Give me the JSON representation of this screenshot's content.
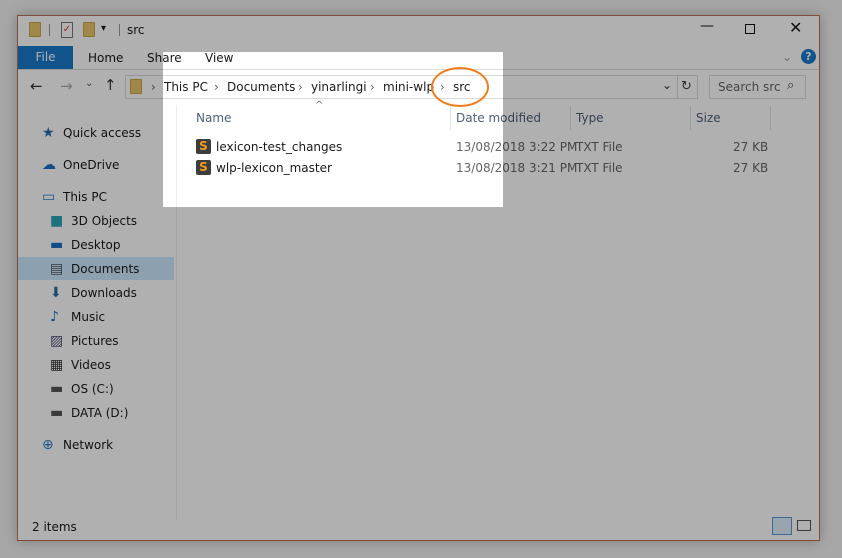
{
  "window": {
    "title": "src",
    "accent": "#1979ca",
    "highlight_color": "#f07c1c"
  },
  "ribbon": {
    "tabs": [
      "File",
      "Home",
      "Share",
      "View"
    ]
  },
  "address": {
    "path": [
      "This PC",
      "Documents",
      "yinarlingi",
      "mini-wlp",
      "src"
    ],
    "search_placeholder": "Search src"
  },
  "columns": {
    "name": "Name",
    "date": "Date modified",
    "type": "Type",
    "size": "Size"
  },
  "files": [
    {
      "name": "lexicon-test_changes",
      "date": "13/08/2018 3:22 PM",
      "type": "TXT File",
      "size": "27 KB",
      "icon": "sublime-text-icon"
    },
    {
      "name": "wlp-lexicon_master",
      "date": "13/08/2018 3:21 PM",
      "type": "TXT File",
      "size": "27 KB",
      "icon": "sublime-text-icon"
    }
  ],
  "sidebar": {
    "items": [
      {
        "label": "Quick access",
        "icon": "star-icon"
      },
      {
        "label": "OneDrive",
        "icon": "cloud-icon"
      },
      {
        "label": "This PC",
        "icon": "computer-icon"
      },
      {
        "label": "3D Objects",
        "icon": "cube-icon"
      },
      {
        "label": "Desktop",
        "icon": "desktop-icon"
      },
      {
        "label": "Documents",
        "icon": "document-icon",
        "selected": true
      },
      {
        "label": "Downloads",
        "icon": "download-icon"
      },
      {
        "label": "Music",
        "icon": "music-icon"
      },
      {
        "label": "Pictures",
        "icon": "picture-icon"
      },
      {
        "label": "Videos",
        "icon": "video-icon"
      },
      {
        "label": "OS (C:)",
        "icon": "drive-icon"
      },
      {
        "label": "DATA (D:)",
        "icon": "drive-icon"
      },
      {
        "label": "Network",
        "icon": "network-icon"
      }
    ]
  },
  "status": {
    "count": "2 items"
  }
}
